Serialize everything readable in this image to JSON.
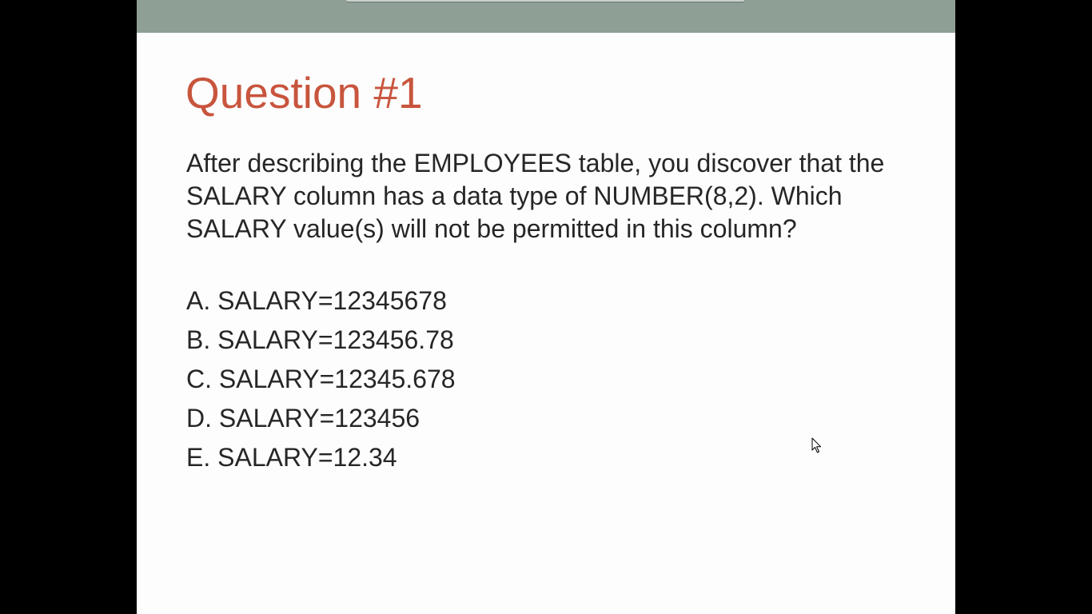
{
  "slide": {
    "title": "Question #1",
    "question": "After describing the EMPLOYEES table, you discover that the SALARY column has a data type of NUMBER(8,2). Which SALARY value(s) will not be permitted in this column?",
    "options": [
      "A. SALARY=12345678",
      "B. SALARY=123456.78",
      "C. SALARY=12345.678",
      "D. SALARY=123456",
      "E. SALARY=12.34"
    ]
  },
  "colors": {
    "title": "#c8553d",
    "top_band": "#8e9f96",
    "text": "#262626",
    "slide_background": "#fdfdfd",
    "letterbox": "#000000"
  },
  "icons": {
    "cursor": "mouse-pointer-icon"
  }
}
